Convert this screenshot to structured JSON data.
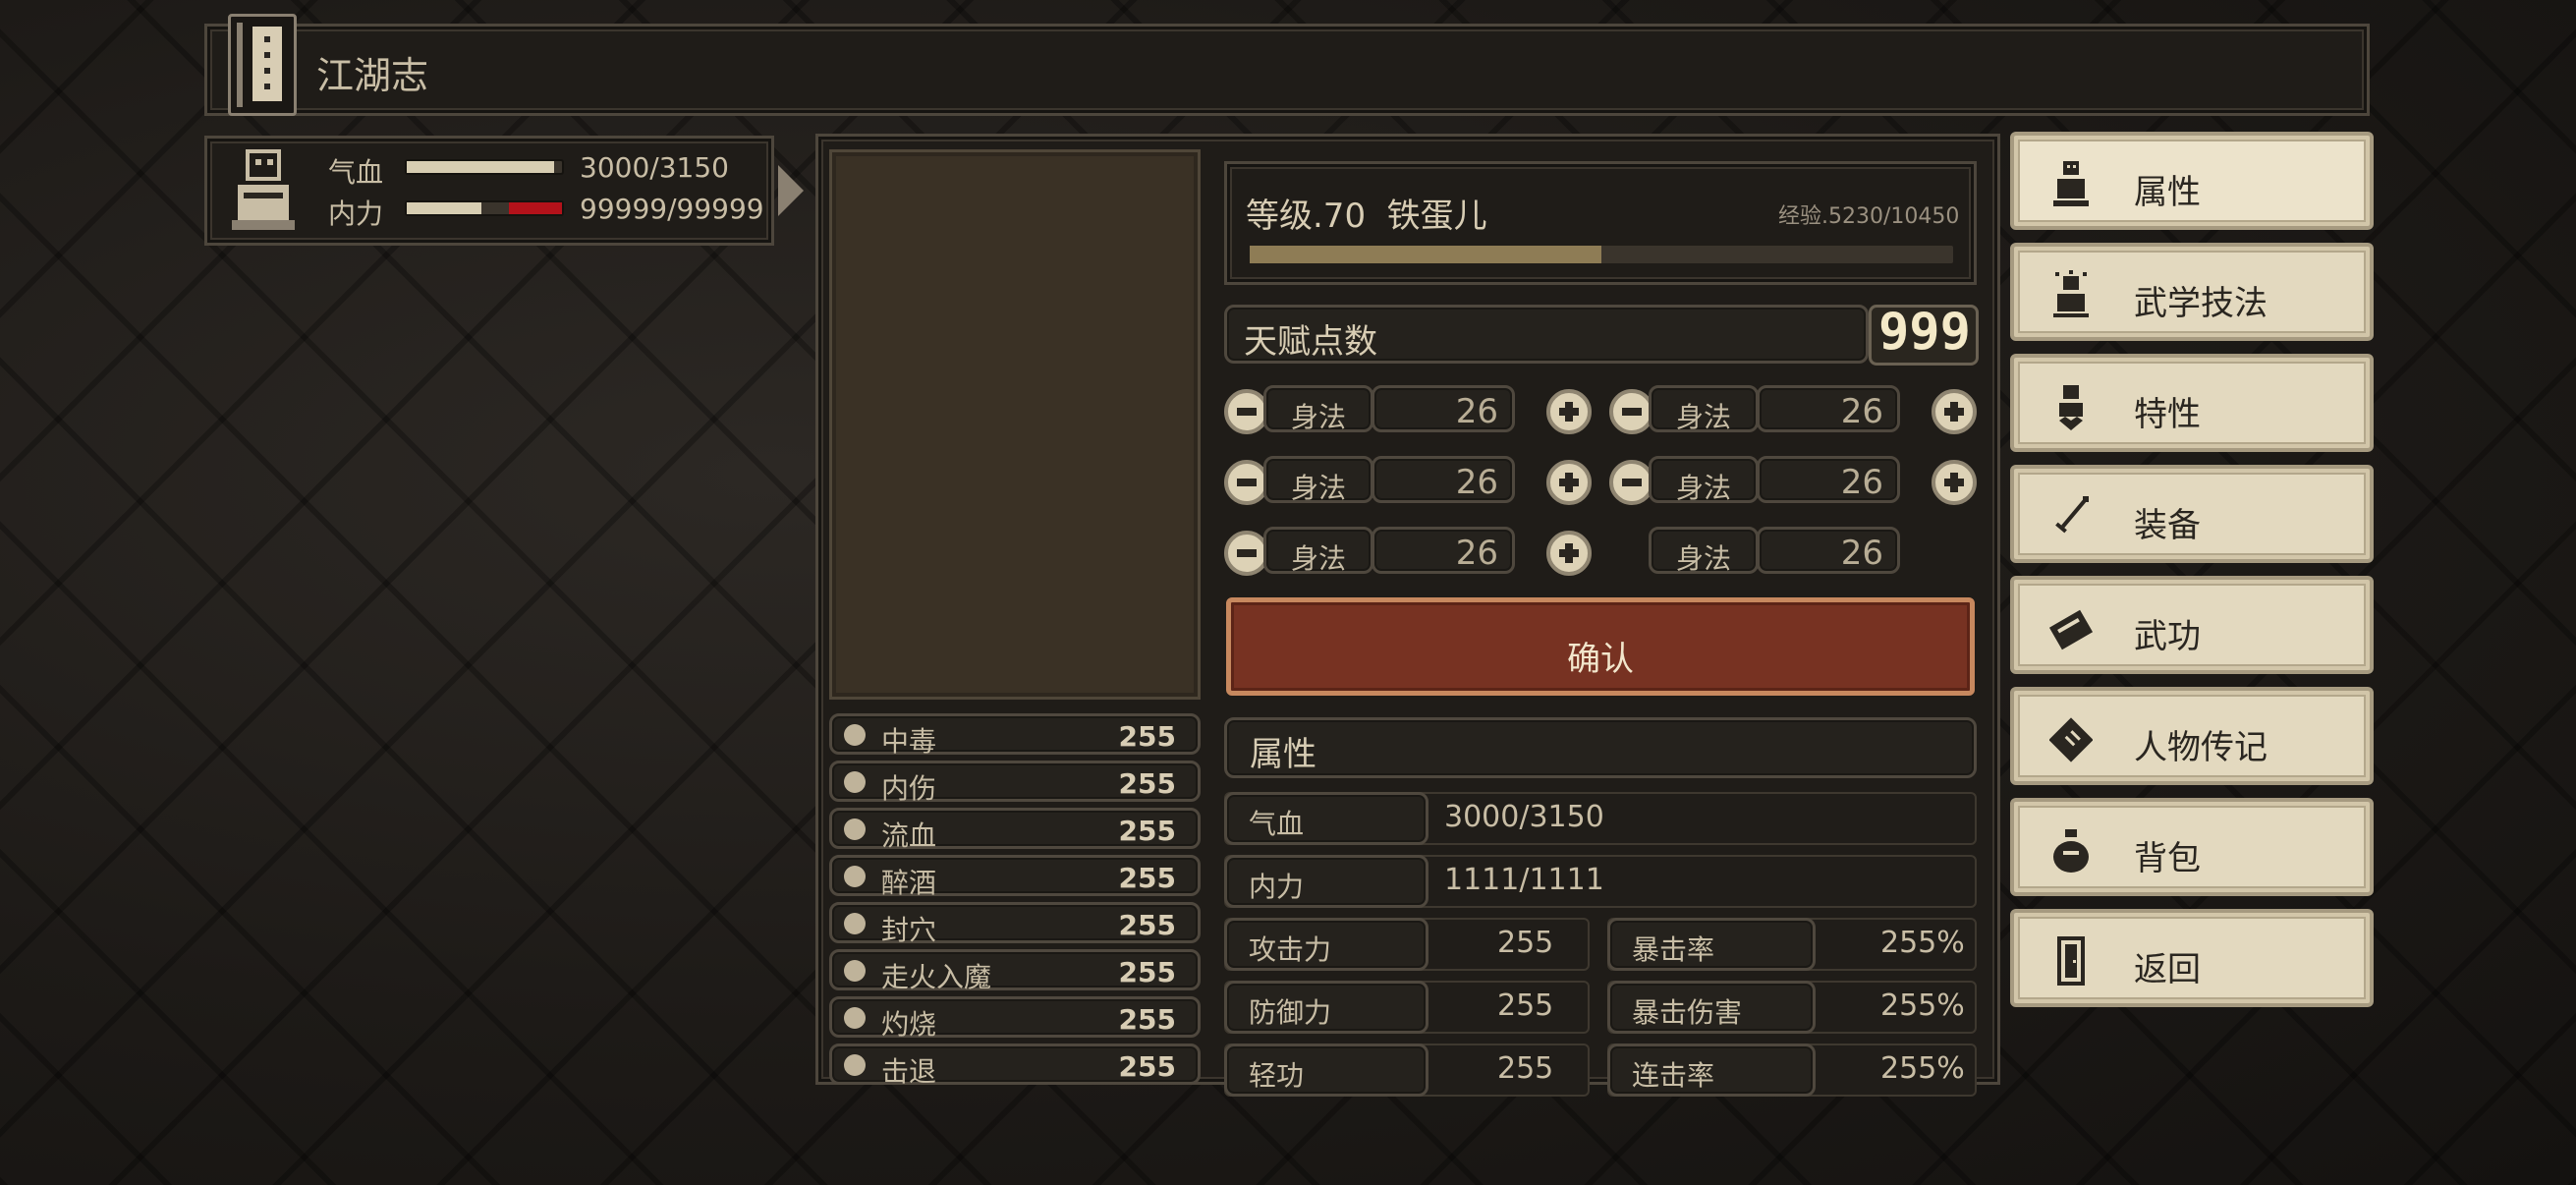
{
  "title_bar": {
    "title": "江湖志"
  },
  "hud": {
    "hp_label": "气血",
    "hp_value": "3000/3150",
    "hp_fraction": 0.95,
    "mp_label": "内力",
    "mp_value": "99999/99999"
  },
  "level": {
    "text": "等级.70  铁蛋儿",
    "exp": "经验.5230/10450",
    "exp_fraction": 0.5
  },
  "talent": {
    "label": "天赋点数",
    "points": "999"
  },
  "allocators": [
    {
      "name": "身法",
      "value": "26"
    },
    {
      "name": "身法",
      "value": "26"
    },
    {
      "name": "身法",
      "value": "26"
    },
    {
      "name": "身法",
      "value": "26"
    },
    {
      "name": "身法",
      "value": "26"
    },
    {
      "name": "身法",
      "value": "26"
    }
  ],
  "confirm_label": "确认",
  "attributes": {
    "header": "属性",
    "hp_label": "气血",
    "hp_value": "3000/3150",
    "mp_label": "内力",
    "mp_value": "1111/1111",
    "attack_label": "攻击力",
    "attack_value": "255",
    "crit_rate_label": "暴击率",
    "crit_rate_value": "255%",
    "defense_label": "防御力",
    "defense_value": "255",
    "crit_damage_label": "暴击伤害",
    "crit_damage_value": "255%",
    "qinggong_label": "轻功",
    "qinggong_value": "255",
    "combo_rate_label": "连击率",
    "combo_rate_value": "255%"
  },
  "status_effects": [
    {
      "name": "中毒",
      "value": "255",
      "icon": "poison-icon"
    },
    {
      "name": "内伤",
      "value": "255",
      "icon": "broken-heart-icon"
    },
    {
      "name": "流血",
      "value": "255",
      "icon": "blood-icon"
    },
    {
      "name": "醉酒",
      "value": "255",
      "icon": "drunk-icon"
    },
    {
      "name": "封穴",
      "value": "255",
      "icon": "needle-icon"
    },
    {
      "name": "走火入魔",
      "value": "255",
      "icon": "demon-icon"
    },
    {
      "name": "灼烧",
      "value": "255",
      "icon": "fire-icon"
    },
    {
      "name": "击退",
      "value": "255",
      "icon": "boot-icon"
    }
  ],
  "menu": [
    {
      "label": "属性",
      "icon": "character-icon"
    },
    {
      "label": "武学技法",
      "icon": "skill-character-icon"
    },
    {
      "label": "特性",
      "icon": "trait-character-icon"
    },
    {
      "label": "装备",
      "icon": "sword-icon"
    },
    {
      "label": "武功",
      "icon": "martial-book-icon"
    },
    {
      "label": "人物传记",
      "icon": "scroll-book-icon"
    },
    {
      "label": "背包",
      "icon": "bag-icon"
    },
    {
      "label": "返回",
      "icon": "door-icon"
    }
  ],
  "colors": {
    "accent_red": "#773222",
    "hp_bar": "#d7cdb2",
    "mp_bar_red": "#b3121a",
    "exp_bar": "#8e7c55"
  }
}
